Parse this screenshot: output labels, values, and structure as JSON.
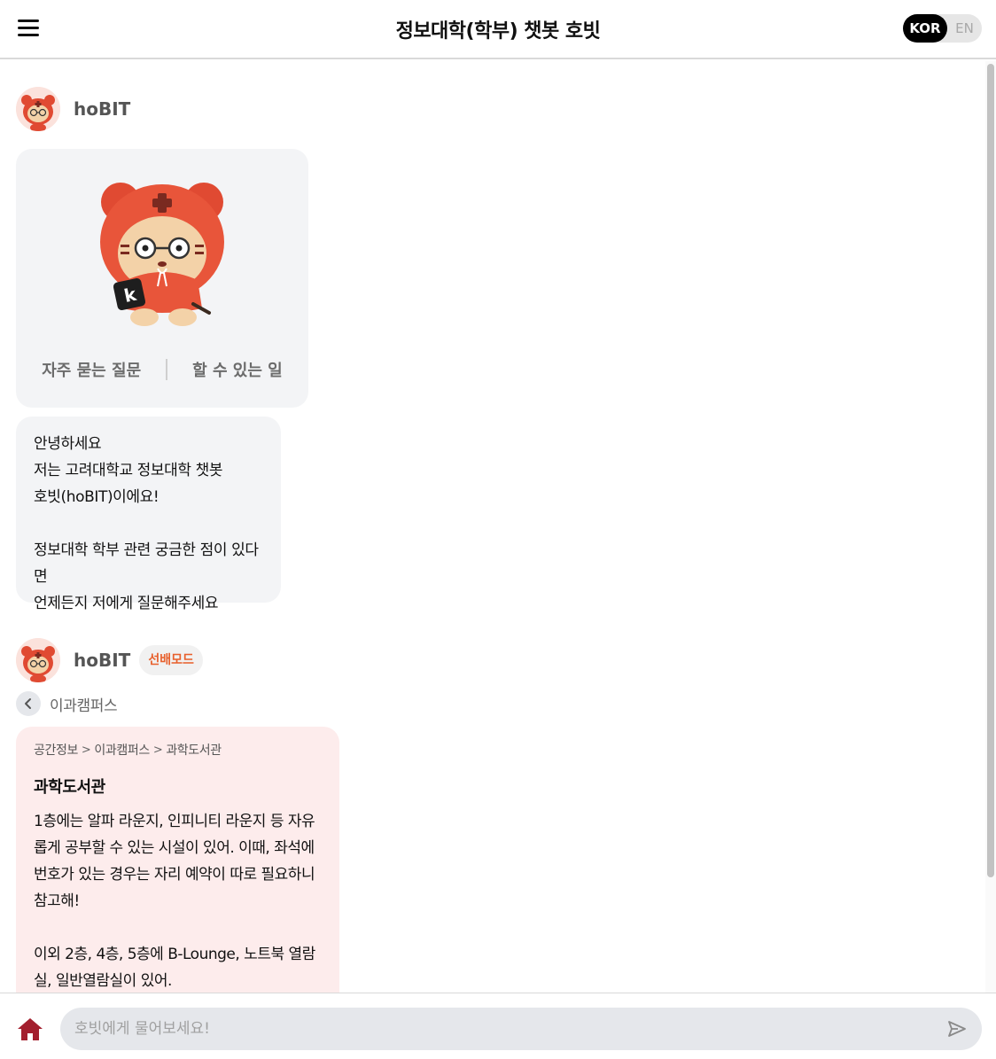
{
  "header": {
    "title": "정보대학(학부) 챗봇 호빗",
    "lang_active": "KOR",
    "lang_inactive": "EN"
  },
  "intro": {
    "bot_name": "hoBIT",
    "faq_link": "자주 묻는 질문",
    "capabilities_link": "할 수 있는 일",
    "greeting_lines": [
      "안녕하세요",
      "저는 고려대학교 정보대학 챗봇",
      "호빗(hoBIT)이에요!",
      "정보대학 학부 관련 궁금한 점이 있다면",
      "언제든지 저에게 질문해주세요"
    ]
  },
  "answer": {
    "bot_name": "hoBIT",
    "mode_badge": "선배모드",
    "back_label": "이과캠퍼스",
    "breadcrumb": [
      "공간정보",
      "이과캠퍼스",
      "과학도서관"
    ],
    "title": "과학도서관",
    "paragraphs": [
      "1층에는 알파 라운지, 인피니티 라운지 등 자유롭게 공부할 수 있는 시설이 있어. 이때, 좌석에 번호가 있는 경우는 자리 예약이 따로 필요하니 참고해!",
      "이외 2층, 4층, 5층에 B-Lounge, 노트북 열람실, 일반열람실이 있어."
    ]
  },
  "composer": {
    "placeholder": "호빗에게 물어보세요!",
    "home_icon": "home-icon",
    "send_icon": "send-icon"
  },
  "colors": {
    "accent_orange": "#e8602c",
    "home_red": "#a31f2e",
    "info_card_bg": "#fdecec",
    "bubble_bg": "#f3f4f6"
  }
}
